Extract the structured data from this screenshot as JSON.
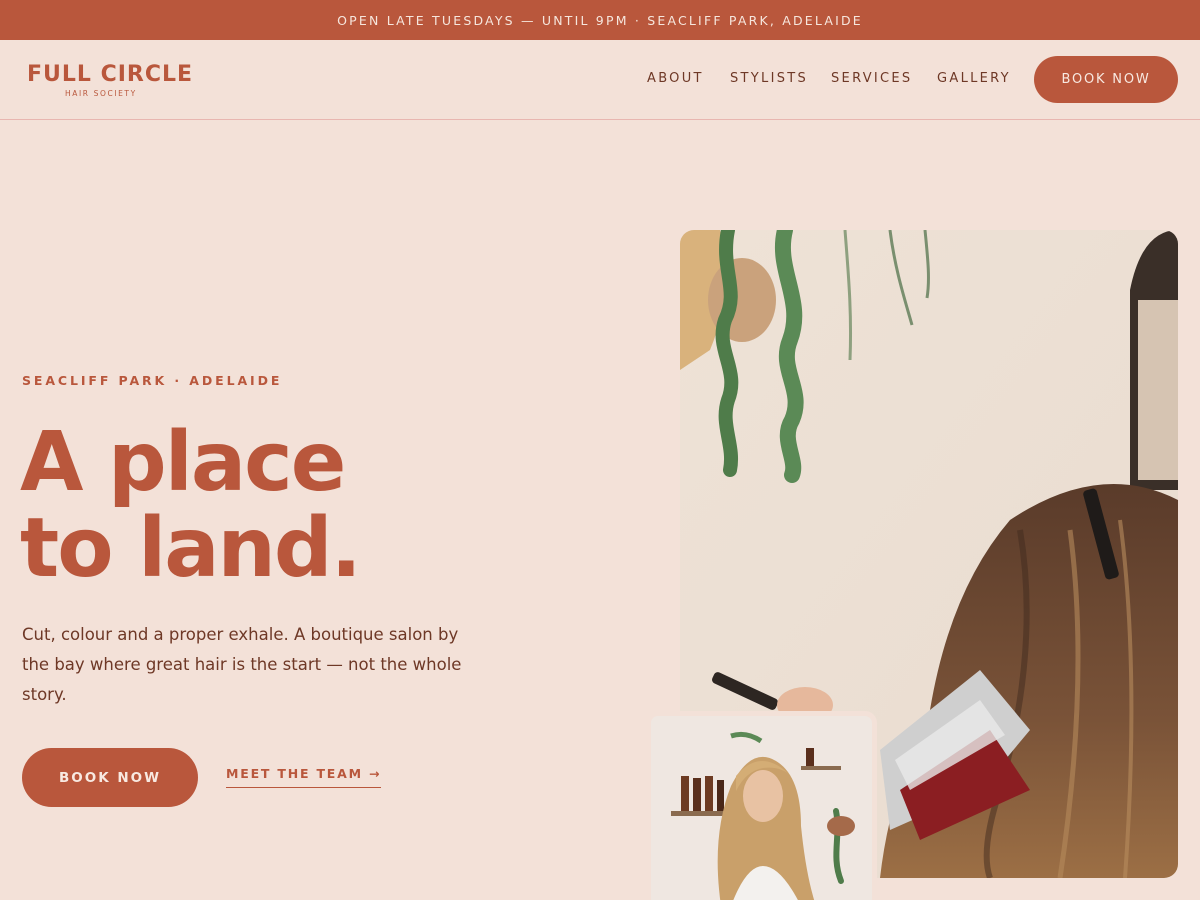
{
  "announcement": "OPEN LATE TUESDAYS — UNTIL 9PM · SEACLIFF PARK, ADELAIDE",
  "logo": {
    "word": "FULL CIRCLE",
    "sub": "HAIR SOCIETY"
  },
  "nav": {
    "items": [
      {
        "label": "ABOUT"
      },
      {
        "label": "STYLISTS"
      },
      {
        "label": "SERVICES"
      },
      {
        "label": "GALLERY"
      }
    ],
    "book_label": "BOOK NOW"
  },
  "hero": {
    "eyebrow": "SEACLIFF PARK · ADELAIDE",
    "headline_line1": "A place",
    "headline_line2": "to land.",
    "intro": "Cut, colour and a proper exhale. A boutique salon by the bay where great hair is the start — not the whole story.",
    "book_label": "BOOK NOW",
    "team_link": "MEET THE TEAM →"
  },
  "colors": {
    "brand": "#b9573c",
    "background": "#f3e1d8",
    "text_dark": "#6e3826"
  }
}
